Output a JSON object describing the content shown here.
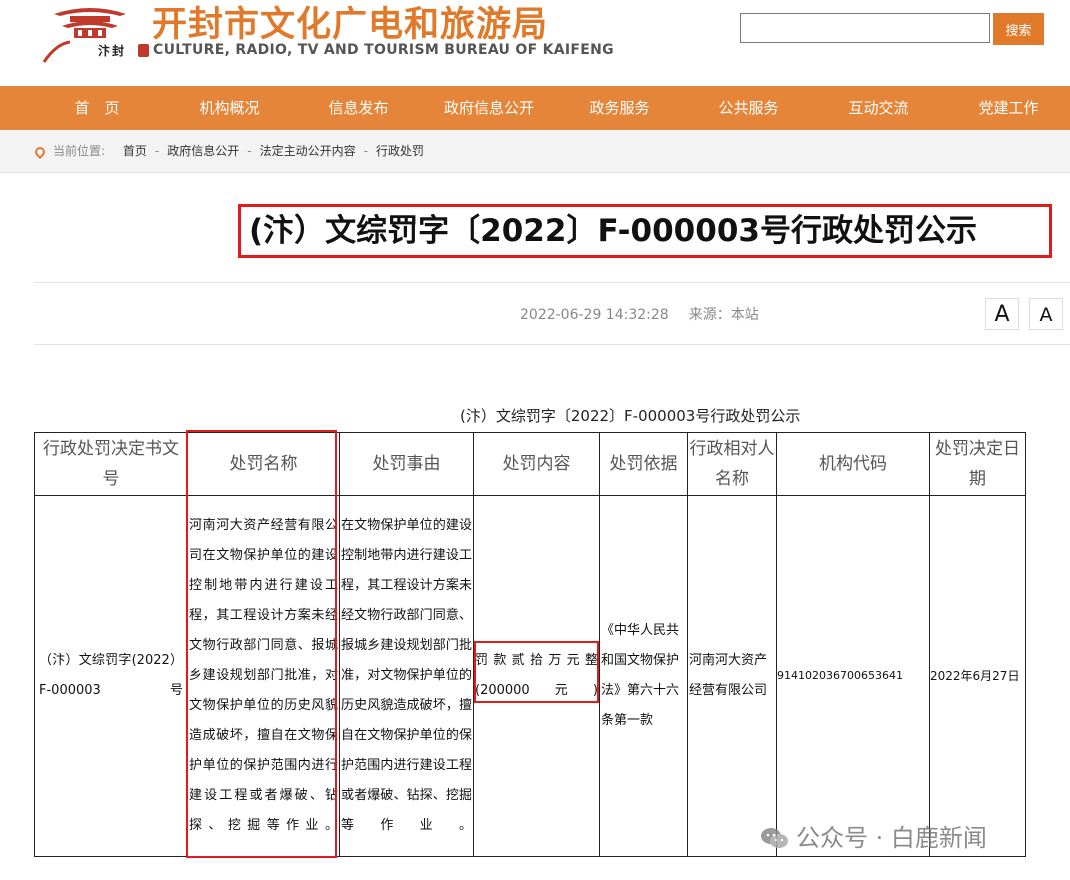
{
  "header": {
    "title": "开封市文化广电和旅游局",
    "subtitle": "CULTURE, RADIO, TV AND TOURISM BUREAU OF KAIFENG",
    "logo_text": "汴封",
    "search": {
      "value": "",
      "button_label": "搜索"
    }
  },
  "nav": {
    "items": [
      {
        "label": "首　页"
      },
      {
        "label": "机构概况"
      },
      {
        "label": "信息发布"
      },
      {
        "label": "政府信息公开"
      },
      {
        "label": "政务服务"
      },
      {
        "label": "公共服务"
      },
      {
        "label": "互动交流"
      },
      {
        "label": "党建工作"
      }
    ]
  },
  "breadcrumb": {
    "prefix": "当前位置:",
    "items": [
      "首页",
      "政府信息公开",
      "法定主动公开内容",
      "行政处罚"
    ],
    "separator": "-"
  },
  "article": {
    "title": "(汴）文综罚字〔2022〕F-000003号行政处罚公示",
    "datetime": "2022-06-29 14:32:28",
    "source": "来源：本站",
    "font_large": "A",
    "font_small": "A",
    "table_caption": "(汴）文综罚字〔2022〕F-000003号行政处罚公示"
  },
  "table": {
    "headers": [
      "行政处罚决定书文号",
      "处罚名称",
      "处罚事由",
      "处罚内容",
      "处罚依据",
      "行政相对人名称",
      "机构代码",
      "处罚决定日期"
    ],
    "row": {
      "doc_no": "（汴）文综罚字(2022）F-000003号",
      "name": "河南河大资产经营有限公司在文物保护单位的建设控制地带内进行建设工程，其工程设计方案未经文物行政部门同意、报城乡建设规划部门批准，对文物保护单位的历史风貌造成破坏，擅自在文物保护单位的保护范围内进行建设工程或者爆破、钻探、挖掘等作业。",
      "reason": "在文物保护单位的建设控制地带内进行建设工程，其工程设计方案未经文物行政部门同意、报城乡建设规划部门批准，对文物保护单位的历史风貌造成破坏，擅自在文物保护单位的保护范围内进行建设工程或者爆破、钻探、挖掘等作业。",
      "content": "罚款贰拾万元整(200000元)",
      "basis": "《中华人民共和国文物保护法》第六十六条第一款",
      "party": "河南河大资产经营有限公司",
      "code": "914102036700653641",
      "date": "2022年6月27日"
    }
  },
  "watermark": "公众号 · 白鹿新闻",
  "colors": {
    "brand_orange": "#e5853a",
    "title_orange": "#e07a2a",
    "highlight_red": "#e31b1b"
  }
}
